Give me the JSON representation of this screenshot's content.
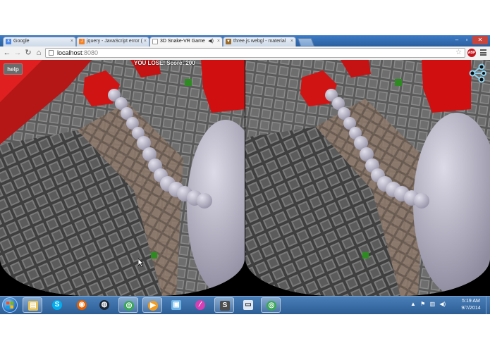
{
  "browser": {
    "tabs": [
      {
        "title": "Google",
        "favicon_color": "#4a86e8",
        "favicon_glyph": "8"
      },
      {
        "title": "jquery - JavaScript error (",
        "favicon_color": "#f48024",
        "favicon_glyph": "J"
      },
      {
        "title": "3D Snake-VR Game",
        "favicon_color": "#ffffff",
        "favicon_glyph": ""
      },
      {
        "title": "three.js webgl - material",
        "favicon_color": "#9b6b2b",
        "favicon_glyph": "▼"
      }
    ],
    "active_tab_index": 2,
    "url_host": "localhost",
    "url_port": ":8080",
    "abp_label": "ABP"
  },
  "game": {
    "help_label": "help",
    "status_text": "YOU LOSE! Score: 200",
    "colors": {
      "snake": "#b8b5c8",
      "food": "#2e8b22",
      "cube": "#d01010",
      "sphere": "#a9a6b7"
    }
  },
  "taskbar": {
    "apps": [
      {
        "name": "explorer",
        "color": "#e6c25a",
        "glyph": "▤",
        "active": true
      },
      {
        "name": "skype",
        "color": "#00aff0",
        "glyph": "S",
        "active": false
      },
      {
        "name": "firefox",
        "color": "#e66000",
        "glyph": "◉",
        "active": false
      },
      {
        "name": "steam",
        "color": "#1b2838",
        "glyph": "◍",
        "active": false
      },
      {
        "name": "chrome",
        "color": "#3aa757",
        "glyph": "◎",
        "active": true
      },
      {
        "name": "media-player",
        "color": "#f29c1f",
        "glyph": "▶",
        "active": true
      },
      {
        "name": "files",
        "color": "#6fb5e8",
        "glyph": "▣",
        "active": false
      },
      {
        "name": "feather",
        "color": "#d43fb3",
        "glyph": "⁄",
        "active": false
      },
      {
        "name": "sublime",
        "color": "#4d4d4d",
        "glyph": "S",
        "active": true
      },
      {
        "name": "window",
        "color": "#dfe9f5",
        "glyph": "▭",
        "active": false
      },
      {
        "name": "chrome-2",
        "color": "#3aa757",
        "glyph": "◎",
        "active": true
      }
    ],
    "clock_time": "5:19 AM",
    "clock_date": "9/7/2014"
  }
}
